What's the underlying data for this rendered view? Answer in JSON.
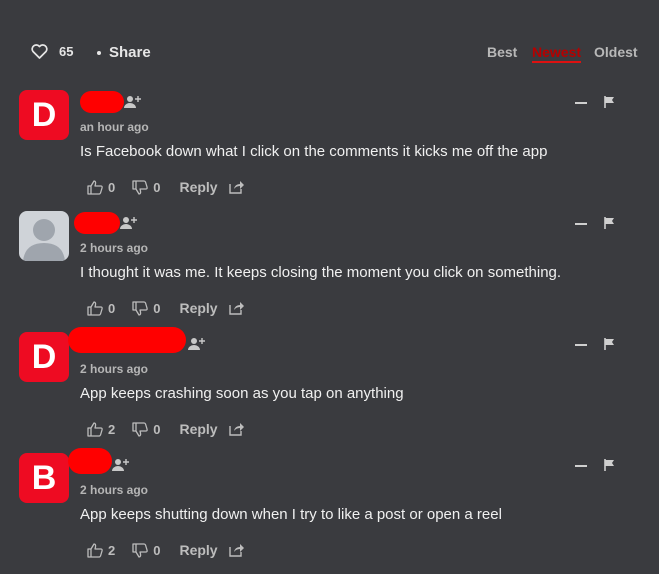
{
  "header": {
    "like_count": "65",
    "share_label": "Share",
    "sort_options": [
      "Best",
      "Newest",
      "Oldest"
    ],
    "active_sort": "Newest"
  },
  "colors": {
    "background": "#3a3b3f",
    "avatar_red": "#ee0b22",
    "redaction": "#ff0000",
    "text": "#f0f0f0",
    "muted": "#b6b6b6"
  },
  "comments": [
    {
      "avatar_letter": "D",
      "avatar_type": "letter",
      "time": "an hour ago",
      "text": "Is Facebook down what I click on the comments it kicks me off the app",
      "upvotes": "0",
      "downvotes": "0",
      "reply_label": "Reply"
    },
    {
      "avatar_letter": "",
      "avatar_type": "default-user",
      "time": "2 hours ago",
      "text": "I thought it was me. It keeps closing the moment you click on something.",
      "upvotes": "0",
      "downvotes": "0",
      "reply_label": "Reply"
    },
    {
      "avatar_letter": "D",
      "avatar_type": "letter",
      "time": "2 hours ago",
      "text": "App keeps crashing soon as you tap on anything",
      "upvotes": "2",
      "downvotes": "0",
      "reply_label": "Reply"
    },
    {
      "avatar_letter": "B",
      "avatar_type": "letter",
      "time": "2 hours ago",
      "text": "App keeps shutting down when I try to like a post or open a reel",
      "upvotes": "2",
      "downvotes": "0",
      "reply_label": "Reply"
    }
  ]
}
